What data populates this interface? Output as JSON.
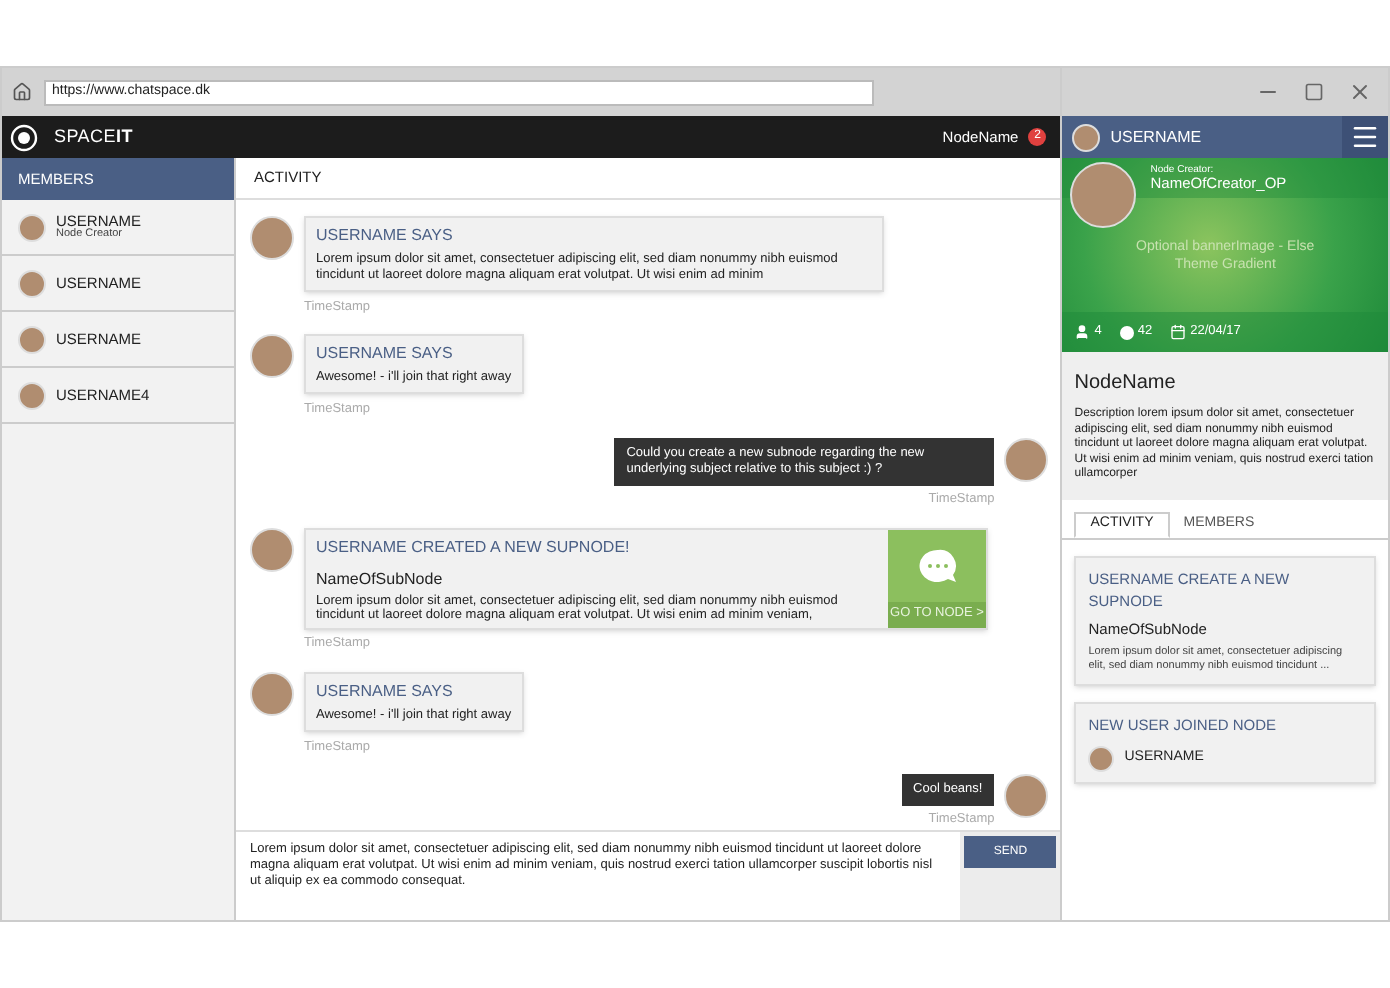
{
  "browser": {
    "url": "https://www.chatspace.dk"
  },
  "header": {
    "logo": "SPACE**IT**",
    "node_name": "NodeName",
    "badge": "2"
  },
  "members": {
    "title": "MEMBERS",
    "items": [
      {
        "name": "USERNAME",
        "role": "Node Creator"
      },
      {
        "name": "USERNAME"
      },
      {
        "name": "USERNAME"
      },
      {
        "name": "USERNAME4"
      }
    ]
  },
  "activity": {
    "title": "ACTIVITY",
    "messages": [
      {
        "kind": "incoming",
        "title": "USERNAME SAYS",
        "body": "Lorem ipsum dolor sit amet, consectetuer adipiscing elit, sed diam nonummy nibh euismod tincidunt ut laoreet dolore magna aliquam erat volutpat. Ut wisi enim ad minim",
        "timestamp": "TimeStamp"
      },
      {
        "kind": "incoming",
        "title": "USERNAME SAYS",
        "body": "Awesome! - i'll join that right away",
        "timestamp": "TimeStamp"
      },
      {
        "kind": "outgoing",
        "body": "Could you create a new subnode regarding the new underlying subject relative to this subject :) ?",
        "timestamp": "TimeStamp"
      },
      {
        "kind": "subnode",
        "title": "USERNAME CREATED A NEW SUPNODE!",
        "subtitle": "NameOfSubNode",
        "body": "Lorem ipsum dolor sit amet, consectetuer adipiscing elit, sed diam nonummy nibh euismod tincidunt ut laoreet dolore magna aliquam erat volutpat. Ut wisi enim ad minim veniam,",
        "action": "GO TO NODE >",
        "timestamp": "TimeStamp"
      },
      {
        "kind": "incoming",
        "title": "USERNAME SAYS",
        "body": "Awesome! - i'll join that right away",
        "timestamp": "TimeStamp"
      },
      {
        "kind": "outgoing",
        "body": "Cool beans!",
        "timestamp": "TimeStamp"
      }
    ]
  },
  "composer": {
    "value": "Lorem ipsum dolor sit amet, consectetuer adipiscing elit, sed diam nonummy nibh euismod tincidunt ut laoreet dolore magna aliquam erat volutpat. Ut wisi enim ad minim veniam, quis nostrud exerci tation ullamcorper suscipit lobortis nisl ut aliquip ex ea commodo consequat.",
    "send": "SEND"
  },
  "panel": {
    "username": "USERNAME",
    "creator_label": "Node Creator:",
    "creator_name": "NameOfCreator_OP",
    "banner_text": "Optional bannerImage - Else Theme Gradient",
    "stats": {
      "members": "4",
      "comments": "42",
      "date": "22/04/17"
    },
    "node_name": "NodeName",
    "description": "Description lorem ipsum dolor sit amet, consectetuer adipiscing elit, sed diam nonummy nibh euismod tincidunt ut laoreet dolore magna aliquam erat volutpat. Ut wisi enim ad minim veniam, quis nostrud exerci tation ullamcorper",
    "tabs": [
      {
        "label": "ACTIVITY",
        "selected": true
      },
      {
        "label": "MEMBERS",
        "selected": false
      }
    ],
    "feed": [
      {
        "kind": "subnode",
        "title": "USERNAME CREATE A NEW SUPNODE",
        "subtitle": "NameOfSubNode",
        "body": "Lorem ipsum dolor sit amet, consectetuer adipiscing elit, sed diam nonummy nibh euismod tincidunt ..."
      },
      {
        "kind": "user",
        "title": "NEW USER JOINED NODE",
        "username": "USERNAME"
      }
    ]
  }
}
